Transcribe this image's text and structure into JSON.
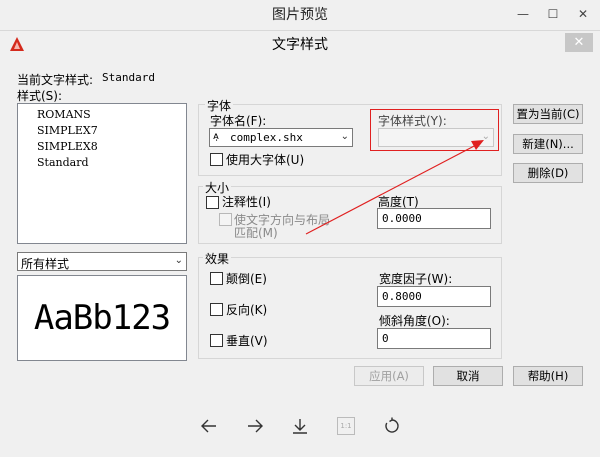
{
  "viewer": {
    "title": "图片预览",
    "controls": {
      "minimize": "—",
      "maximize": "☐",
      "close": "✕"
    }
  },
  "dialog": {
    "title": "文字样式",
    "close": "✕",
    "current_style_label": "当前文字样式:",
    "current_style_value": "Standard",
    "styles_label": "样式(S):",
    "styles": [
      "ROMANS",
      "SIMPLEX7",
      "SIMPLEX8",
      "Standard"
    ],
    "filter": {
      "value": "所有样式"
    },
    "preview_text": "AaBb123",
    "font_group": {
      "title": "字体",
      "font_name_label": "字体名(F):",
      "font_name_value": "complex.shx",
      "font_style_label": "字体样式(Y):",
      "font_style_value": "",
      "bigfont_label": "使用大字体(U)"
    },
    "size_group": {
      "title": "大小",
      "annotative_label": "注释性(I)",
      "match_label_line1": "使文字方向与布局",
      "match_label_line2": "匹配(M)",
      "height_label": "高度(T)",
      "height_value": "0.0000"
    },
    "effects_group": {
      "title": "效果",
      "upside_down_label": "颠倒(E)",
      "backwards_label": "反向(K)",
      "vertical_label": "垂直(V)",
      "width_factor_label": "宽度因子(W):",
      "width_factor_value": "0.8000",
      "oblique_label": "倾斜角度(O):",
      "oblique_value": "0"
    },
    "buttons": {
      "set_current": "置为当前(C)",
      "new": "新建(N)...",
      "delete": "删除(D)",
      "apply": "应用(A)",
      "cancel": "取消",
      "help": "帮助(H)"
    }
  },
  "annotation_color": "#e02020",
  "toolbar": {
    "icons": [
      "arrow-left-icon",
      "arrow-right-icon",
      "download-icon",
      "actual-size-icon",
      "rotate-icon"
    ],
    "actual_size_text": "1:1"
  }
}
